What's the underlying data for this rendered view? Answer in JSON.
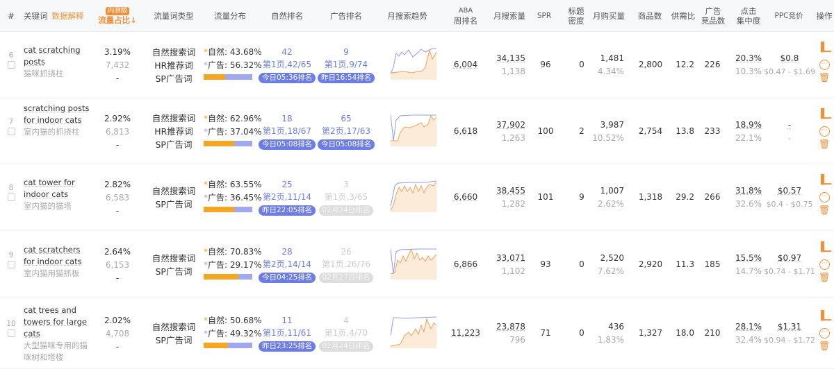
{
  "header": {
    "index": "#",
    "keyword": "关键词",
    "data_explain": "数据解释",
    "beta_badge": "内测版",
    "traffic_share": "流量占比↓",
    "traffic_type": "流量词类型",
    "traffic_dist": "流量分布",
    "natural_rank": "自然排名",
    "ad_rank": "广告排名",
    "trend": "月搜索趋势",
    "aba_1": "ABA",
    "aba_2": "周排名",
    "monthly_search": "月搜索量",
    "spr": "SPR",
    "title_density_1": "标题",
    "title_density_2": "密度",
    "monthly_purchase": "月购买量",
    "products": "商品数",
    "supply_demand": "供需比",
    "ad_products_1": "广告",
    "ad_products_2": "竞品数",
    "click_conc_1": "点击",
    "click_conc_2": "集中度",
    "ppc": "PPC竞价",
    "actions": "操作"
  },
  "labels": {
    "natural": "自然:",
    "ad": "广告:"
  },
  "colors": {
    "accent": "#f0913a",
    "natural_bar": "#f5a623",
    "ad_bar": "#9fa8f0",
    "badge": "#6b7be8"
  },
  "rows": [
    {
      "index": "6",
      "keyword": "cat scratching posts",
      "translation": "猫咪抓挠柱",
      "share": "3.19%",
      "share_count": "7,432",
      "share_extra": "-",
      "types": [
        "自然搜索词",
        "HR推荐词",
        "SP广告词"
      ],
      "natural_pct": "43.68%",
      "ad_pct": "56.32%",
      "natural_frac": 0.4368,
      "nat_rank": "42",
      "nat_page": "第1页,42/65",
      "nat_time": "今日05:36排名",
      "nat_active": true,
      "ad_rank": "9",
      "ad_page": "第1页,9/74",
      "ad_time": "昨日16:54排名",
      "ad_active": true,
      "aba": "6,004",
      "search": "34,135",
      "search_sub": "1,138",
      "spr": "96",
      "density": "0",
      "purchase": "1,481",
      "purchase_rate": "4.34%",
      "products": "2,800",
      "ratio": "12.2",
      "ad_products": "226",
      "click": "20.3%",
      "click_sub": "10.3%",
      "ppc": "$0.8",
      "ppc_range": "$0.47 - $1.69"
    },
    {
      "index": "7",
      "keyword": "scratching posts for indoor cats",
      "translation": "室内猫的抓挠柱",
      "share": "2.92%",
      "share_count": "6,813",
      "share_extra": "-",
      "types": [
        "自然搜索词",
        "HR推荐词",
        "SP广告词"
      ],
      "natural_pct": "62.96%",
      "ad_pct": "37.04%",
      "natural_frac": 0.6296,
      "nat_rank": "18",
      "nat_page": "第1页,18/67",
      "nat_time": "今日05:08排名",
      "nat_active": true,
      "ad_rank": "65",
      "ad_page": "第2页,17/63",
      "ad_time": "今日05:08排名",
      "ad_active": true,
      "aba": "6,618",
      "search": "37,902",
      "search_sub": "1,263",
      "spr": "100",
      "density": "2",
      "purchase": "3,987",
      "purchase_rate": "10.52%",
      "products": "2,754",
      "ratio": "13.8",
      "ad_products": "233",
      "click": "18.9%",
      "click_sub": "22.1%",
      "ppc": "-",
      "ppc_range": "-"
    },
    {
      "index": "8",
      "keyword": "cat tower for indoor cats",
      "translation": "室内猫的猫塔",
      "share": "2.82%",
      "share_count": "6,583",
      "share_extra": "-",
      "types": [
        "自然搜索词",
        "SP广告词"
      ],
      "natural_pct": "63.55%",
      "ad_pct": "36.45%",
      "natural_frac": 0.6355,
      "nat_rank": "25",
      "nat_page": "第2页,11/14",
      "nat_time": "昨日22:05排名",
      "nat_active": true,
      "ad_rank": "3",
      "ad_page": "第1页,3/65",
      "ad_time": "02月24日排名",
      "ad_active": false,
      "aba": "6,660",
      "search": "38,455",
      "search_sub": "1,282",
      "spr": "101",
      "density": "9",
      "purchase": "1,007",
      "purchase_rate": "2.62%",
      "products": "1,318",
      "ratio": "29.2",
      "ad_products": "266",
      "click": "31.8%",
      "click_sub": "32.6%",
      "ppc": "$0.57",
      "ppc_range": "$0.4 - $0.75"
    },
    {
      "index": "9",
      "keyword": "cat scratchers for indoor cats",
      "translation": "室内猫用猫抓板",
      "share": "2.64%",
      "share_count": "6,153",
      "share_extra": "-",
      "types": [
        "自然搜索词",
        "SP广告词"
      ],
      "natural_pct": "70.83%",
      "ad_pct": "29.17%",
      "natural_frac": 0.7083,
      "nat_rank": "28",
      "nat_page": "第2页,14/14",
      "nat_time": "今日04:25排名",
      "nat_active": true,
      "ad_rank": "26",
      "ad_page": "第1页,26/76",
      "ad_time": "02月27日排名",
      "ad_active": false,
      "aba": "6,866",
      "search": "33,071",
      "search_sub": "1,102",
      "spr": "93",
      "density": "0",
      "purchase": "2,520",
      "purchase_rate": "7.62%",
      "products": "2,920",
      "ratio": "11.3",
      "ad_products": "185",
      "click": "15.5%",
      "click_sub": "14.7%",
      "ppc": "$0.97",
      "ppc_range": "$0.74 - $1.71"
    },
    {
      "index": "10",
      "keyword": "cat trees and towers for large cats",
      "translation": "大型猫咪专用的猫咪树和塔楼",
      "share": "2.02%",
      "share_count": "4,708",
      "share_extra": "-",
      "types": [
        "自然搜索词",
        "SP广告词"
      ],
      "natural_pct": "50.68%",
      "ad_pct": "49.32%",
      "natural_frac": 0.5068,
      "nat_rank": "11",
      "nat_page": "第1页,11/61",
      "nat_time": "昨日23:25排名",
      "nat_active": true,
      "ad_rank": "4",
      "ad_page": "第1页,4/70",
      "ad_time": "02月24日排名",
      "ad_active": false,
      "aba": "11,223",
      "search": "23,878",
      "search_sub": "796",
      "spr": "71",
      "density": "0",
      "purchase": "436",
      "purchase_rate": "1.83%",
      "products": "1,327",
      "ratio": "18.0",
      "ad_products": "210",
      "click": "28.1%",
      "click_sub": "32.4%",
      "ppc": "$1.31",
      "ppc_range": "$0.94 - $1.72"
    }
  ]
}
